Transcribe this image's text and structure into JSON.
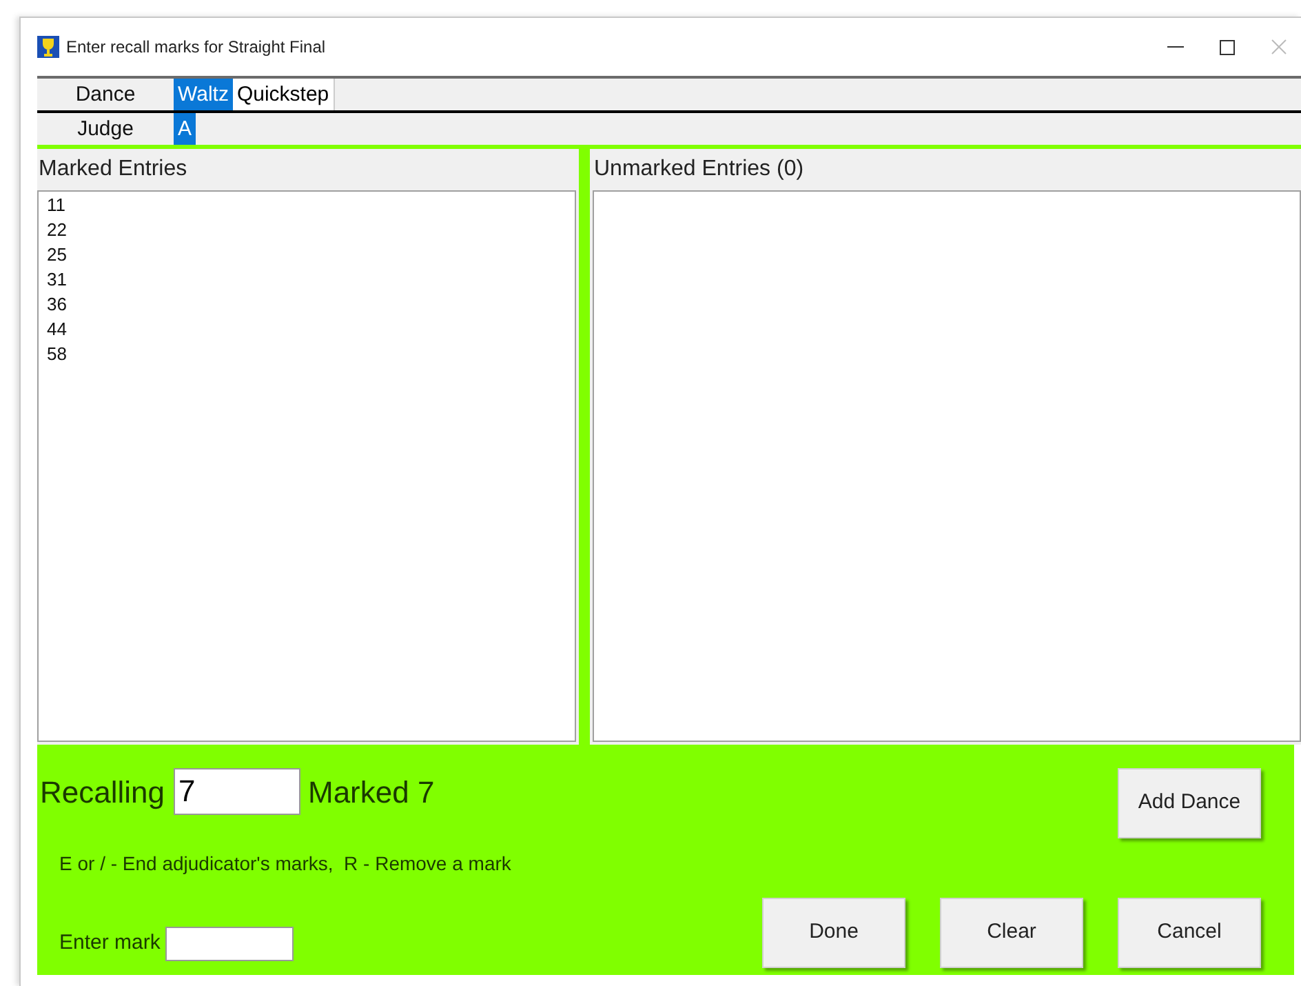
{
  "window": {
    "title": "Enter recall marks for Straight Final"
  },
  "dance_row": {
    "label": "Dance",
    "tabs": [
      {
        "label": "Waltz",
        "selected": true
      },
      {
        "label": "Quickstep",
        "selected": false
      }
    ]
  },
  "judge_row": {
    "label": "Judge",
    "tabs": [
      {
        "label": "A",
        "selected": true
      }
    ]
  },
  "marked_entries": {
    "title": "Marked Entries",
    "items": [
      "11",
      "22",
      "25",
      "31",
      "36",
      "44",
      "58"
    ]
  },
  "unmarked_entries": {
    "title": "Unmarked Entries (0)"
  },
  "recall": {
    "label": "Recalling",
    "value": "7",
    "marked": "Marked 7",
    "help": "E or / - End adjudicator's marks,  R - Remove a mark",
    "enter_label": "Enter mark"
  },
  "buttons": {
    "add": "Add Dance",
    "actions": [
      "Done",
      "Clear",
      "Cancel"
    ]
  }
}
